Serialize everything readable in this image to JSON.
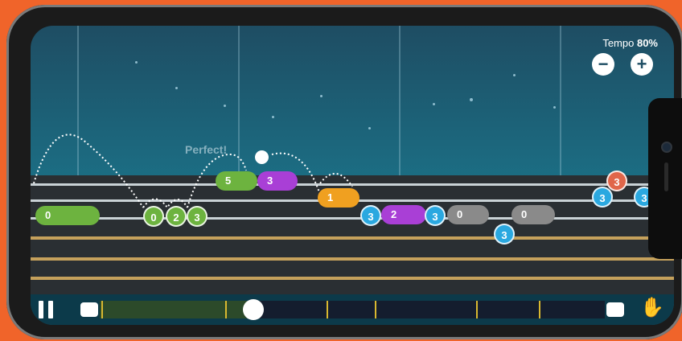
{
  "feedback": {
    "text": "Perfect!"
  },
  "tempo": {
    "label": "Tempo",
    "value": "80%",
    "decrease_icon": "minus-icon",
    "increase_icon": "plus-icon"
  },
  "notes": {
    "green": [
      "0",
      "0",
      "2",
      "3",
      "5"
    ],
    "purple": [
      "3",
      "2"
    ],
    "orange": [
      "1"
    ],
    "blue": [
      "3",
      "3",
      "3",
      "3",
      "3"
    ],
    "gray": [
      "0",
      "0"
    ],
    "red": [
      "3"
    ]
  },
  "transport": {
    "pause_icon": "pause-icon",
    "loop_start_icon": "loop-start-icon",
    "loop_end_icon": "loop-end-icon",
    "hand_icon": "hand-icon"
  },
  "song_progress": 0.31,
  "colors": {
    "green": "#6db33f",
    "purple": "#a93fd6",
    "orange": "#f0a020",
    "blue": "#2aa8e0",
    "gray": "#8a8a8a",
    "red": "#e0664a",
    "background": "#f0642a"
  }
}
